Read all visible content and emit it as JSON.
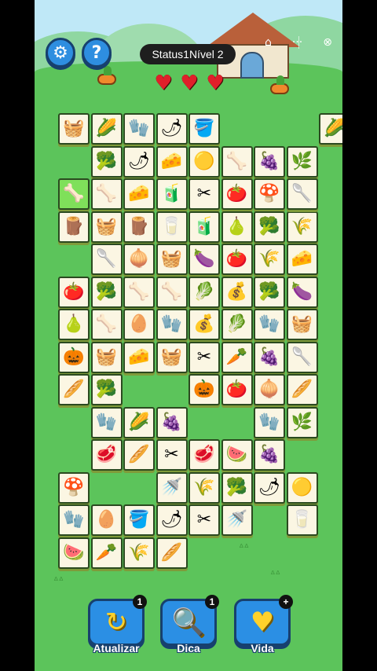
{
  "hud": {
    "settings_icon": "gear-icon",
    "help_label": "?",
    "status": "Status1Nível 2",
    "hearts": [
      "♥",
      "♥",
      "♥"
    ],
    "home_icon": "⌂",
    "more_label": "···",
    "close_icon": "⊗"
  },
  "board": {
    "selected_tile": "bone",
    "tiles": [
      [
        "🧺",
        "🌽",
        "🧤",
        "🌶",
        "🪣",
        "",
        "",
        "",
        "🌽"
      ],
      [
        "",
        "🥦",
        "🌶",
        "🧀",
        "🟡",
        "🦴",
        "🍇",
        "🌿",
        ""
      ],
      [
        "🦴",
        "🦴",
        "🧀",
        "🧃",
        "✂",
        "🍅",
        "🍄",
        "🥄",
        ""
      ],
      [
        "🪵",
        "🧺",
        "🪵",
        "🥛",
        "🧃",
        "🍐",
        "🥦",
        "🌾",
        ""
      ],
      [
        "",
        "🥄",
        "🧅",
        "🧺",
        "🍆",
        "🍅",
        "🌾",
        "🧀",
        ""
      ],
      [
        "🍅",
        "🥦",
        "🦴",
        "🦴",
        "🥬",
        "💰",
        "🥦",
        "🍆",
        ""
      ],
      [
        "🍐",
        "🦴",
        "🥚",
        "🧤",
        "💰",
        "🥬",
        "🧤",
        "🧺",
        ""
      ],
      [
        "🎃",
        "🧺",
        "🧀",
        "🧺",
        "✂",
        "🥕",
        "🍇",
        "🥄",
        ""
      ],
      [
        "🥖",
        "🥦",
        "",
        "",
        "🎃",
        "🍅",
        "🧅",
        "🥖",
        ""
      ],
      [
        "",
        "🧤",
        "🌽",
        "🍇",
        "",
        "",
        "🧤",
        "🌿",
        ""
      ],
      [
        "",
        "🥩",
        "🥖",
        "✂",
        "🥩",
        "🍉",
        "🍇",
        "",
        ""
      ],
      [
        "🍄",
        "",
        "",
        "🚿",
        "🌾",
        "🥦",
        "🌶",
        "🟡",
        ""
      ],
      [
        "🧤",
        "🥚",
        "🪣",
        "🌶",
        "✂",
        "🚿",
        "",
        "🥛",
        ""
      ],
      [
        "🍉",
        "🥕",
        "🌾",
        "🥖",
        "",
        "",
        "",
        "",
        ""
      ]
    ],
    "extra_tile": "🥄"
  },
  "powerups": [
    {
      "label": "Atualizar",
      "icon": "↻",
      "count": "1",
      "name": "refresh"
    },
    {
      "label": "Dica",
      "icon": "🔍",
      "count": "1",
      "name": "hint"
    },
    {
      "label": "Vida",
      "icon": "♥",
      "count": "+",
      "name": "life"
    }
  ]
}
